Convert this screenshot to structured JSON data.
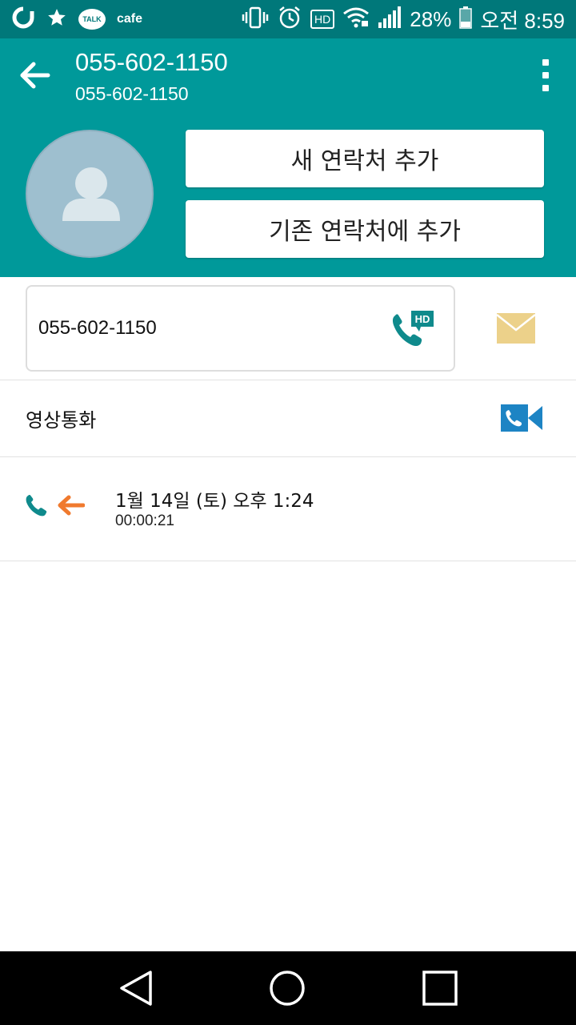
{
  "status_bar": {
    "cafe_label": "cafe",
    "talk_label": "TALK",
    "hd_label": "HD",
    "battery": "28%",
    "time": "오전 8:59"
  },
  "header": {
    "title": "055-602-1150",
    "subtitle": "055-602-1150",
    "add_new_contact": "새 연락처 추가",
    "add_to_existing": "기존 연락처에 추가"
  },
  "phone": {
    "number": "055-602-1150",
    "hd_badge": "HD"
  },
  "video_call": {
    "label": "영상통화"
  },
  "call_log": {
    "date": "1월 14일 (토) 오후 1:24",
    "duration": "00:00:21"
  },
  "colors": {
    "status_bar": "#00787a",
    "header": "#00999a",
    "call_green": "#0f8a8c",
    "incoming_arrow": "#f07a2e",
    "message_icon": "#ecd18a",
    "video_icon": "#1d84c4",
    "avatar": "#9ebfcf"
  },
  "icons": {
    "back": "arrow-left-icon",
    "menu": "more-vert-icon",
    "avatar": "person-icon",
    "hd_call": "hd-phone-icon",
    "message": "envelope-icon",
    "video": "video-call-icon",
    "call_type": "phone-icon",
    "direction": "incoming-arrow-icon",
    "nav_back": "triangle-back-icon",
    "nav_home": "circle-home-icon",
    "nav_recent": "square-recent-icon"
  }
}
